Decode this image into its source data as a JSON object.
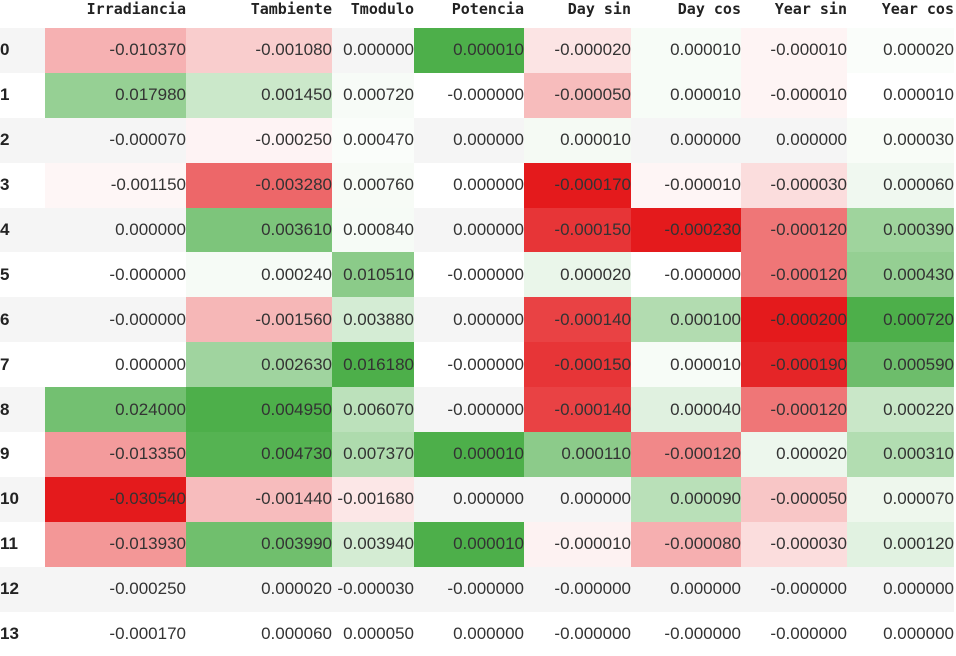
{
  "chart_data": {
    "type": "table",
    "columns": [
      "Irradiancia",
      "Tambiente",
      "Tmodulo",
      "Potencia",
      "Day sin",
      "Day cos",
      "Year sin",
      "Year cos"
    ],
    "index": [
      "0",
      "1",
      "2",
      "3",
      "4",
      "5",
      "6",
      "7",
      "8",
      "9",
      "10",
      "11",
      "12",
      "13"
    ],
    "rows": [
      [
        "-0.010370",
        "-0.001080",
        "0.000000",
        "0.000010",
        "-0.000020",
        "0.000010",
        "-0.000010",
        "0.000020"
      ],
      [
        "0.017980",
        "0.001450",
        "0.000720",
        "-0.000000",
        "-0.000050",
        "0.000010",
        "-0.000010",
        "0.000010"
      ],
      [
        "-0.000070",
        "-0.000250",
        "0.000470",
        "0.000000",
        "0.000010",
        "0.000000",
        "0.000000",
        "0.000030"
      ],
      [
        "-0.001150",
        "-0.003280",
        "0.000760",
        "0.000000",
        "-0.000170",
        "-0.000010",
        "-0.000030",
        "0.000060"
      ],
      [
        "0.000000",
        "0.003610",
        "0.000840",
        "0.000000",
        "-0.000150",
        "-0.000230",
        "-0.000120",
        "0.000390"
      ],
      [
        "-0.000000",
        "0.000240",
        "0.010510",
        "-0.000000",
        "0.000020",
        "-0.000000",
        "-0.000120",
        "0.000430"
      ],
      [
        "-0.000000",
        "-0.001560",
        "0.003880",
        "0.000000",
        "-0.000140",
        "0.000100",
        "-0.000200",
        "0.000720"
      ],
      [
        "0.000000",
        "0.002630",
        "0.016180",
        "-0.000000",
        "-0.000150",
        "0.000010",
        "-0.000190",
        "0.000590"
      ],
      [
        "0.024000",
        "0.004950",
        "0.006070",
        "-0.000000",
        "-0.000140",
        "0.000040",
        "-0.000120",
        "0.000220"
      ],
      [
        "-0.013350",
        "0.004730",
        "0.007370",
        "0.000010",
        "0.000110",
        "-0.000120",
        "0.000020",
        "0.000310"
      ],
      [
        "-0.030540",
        "-0.001440",
        "-0.001680",
        "0.000000",
        "0.000000",
        "0.000090",
        "-0.000050",
        "0.000070"
      ],
      [
        "-0.013930",
        "0.003990",
        "0.003940",
        "0.000010",
        "-0.000010",
        "-0.000080",
        "-0.000030",
        "0.000120"
      ],
      [
        "-0.000250",
        "0.000020",
        "-0.000030",
        "-0.000000",
        "-0.000000",
        "0.000000",
        "-0.000000",
        "0.000000"
      ],
      [
        "-0.000170",
        "0.000060",
        "0.000050",
        "0.000000",
        "-0.000000",
        "-0.000000",
        "-0.000000",
        "0.000000"
      ]
    ],
    "color_scale": {
      "negative_color": "#e41a1c",
      "neutral_color": "#ffffff",
      "positive_color": "#4daf4a",
      "scope": "per-column"
    }
  }
}
